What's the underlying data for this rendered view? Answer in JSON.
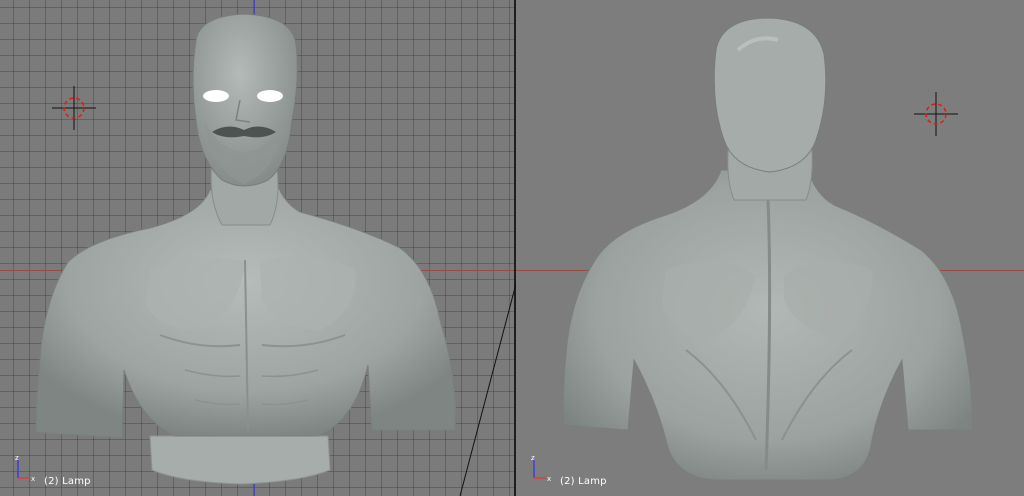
{
  "viewports": {
    "left": {
      "label": "(2) Lamp",
      "view": "front",
      "grid": true,
      "axis_gizmo": {
        "vertical": "z",
        "horizontal": "x"
      }
    },
    "right": {
      "label": "(2) Lamp",
      "view": "back",
      "grid": false,
      "axis_gizmo": {
        "vertical": "z",
        "horizontal": "x"
      }
    }
  },
  "colors": {
    "viewport_bg": "#7b7b7b",
    "grid_line": "#5a5a5a",
    "x_axis_line": "#9a4a44",
    "z_axis_line": "#4a4aa8",
    "mesh": "#a4aaa7",
    "divider": "#1e1e1e",
    "cursor_red": "#d42020"
  },
  "icons": {
    "cursor": "3d-cursor-icon",
    "gizmo": "axis-gizmo-icon"
  }
}
